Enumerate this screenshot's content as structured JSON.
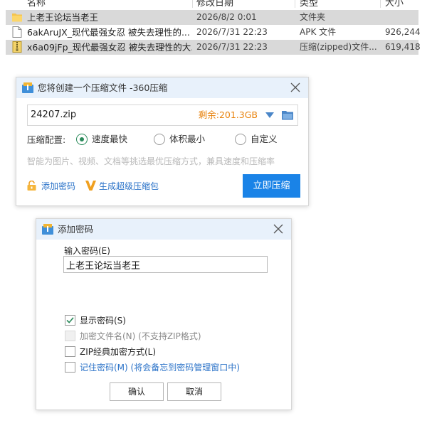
{
  "file_list": {
    "columns": [
      "名称",
      "修改日期",
      "类型",
      "大小"
    ],
    "rows": [
      {
        "name": "上老王论坛当老王",
        "date": "2026/8/2 0:01",
        "type": "文件夹",
        "size": "",
        "icon": "folder-icon",
        "selected": true
      },
      {
        "name": "6akAruJX_现代最强女忍 被失去理性的...",
        "date": "2026/7/31 22:23",
        "type": "APK 文件",
        "size": "926,244",
        "icon": "file-icon",
        "selected": false
      },
      {
        "name": "x6a09jFp_现代最强女忍 被失去理性的大...",
        "date": "2026/7/31 22:23",
        "type": "压缩(zipped)文件...",
        "size": "619,418",
        "icon": "zip-file-icon",
        "selected": true
      }
    ]
  },
  "compress_dialog": {
    "title": "您将创建一个压缩文件 -360压缩",
    "archive_name": "24207.zip",
    "free_space": "剩余:201.3GB",
    "config_label": "压缩配置:",
    "options": [
      {
        "label": "速度最快",
        "selected": true
      },
      {
        "label": "体积最小",
        "selected": false
      },
      {
        "label": "自定义",
        "selected": false
      }
    ],
    "hint": "智能为图片、视频、文档等挑选最优压缩方式，兼具速度和压缩率",
    "add_password": "添加密码",
    "super_pack": "生成超级压缩包",
    "compress_button": "立即压缩",
    "colors": {
      "accent": "#1a83e7",
      "link": "#2a72c8",
      "free_space": "#e8830e",
      "radio": "#2a8a5a"
    }
  },
  "password_dialog": {
    "title": "添加密码",
    "password_label": "输入密码(E)",
    "password_value": "上老王论坛当老王",
    "checkboxes": [
      {
        "label": "显示密码(S)",
        "checked": true,
        "disabled": false
      },
      {
        "label": "加密文件名(N) (不支持ZIP格式)",
        "checked": false,
        "disabled": true
      },
      {
        "label": "ZIP经典加密方式(L)",
        "checked": false,
        "disabled": false
      },
      {
        "label": "记住密码(M) (将会备忘到密码管理窗口中)",
        "checked": false,
        "disabled": false
      }
    ],
    "ok_button": "确认",
    "cancel_button": "取消"
  }
}
